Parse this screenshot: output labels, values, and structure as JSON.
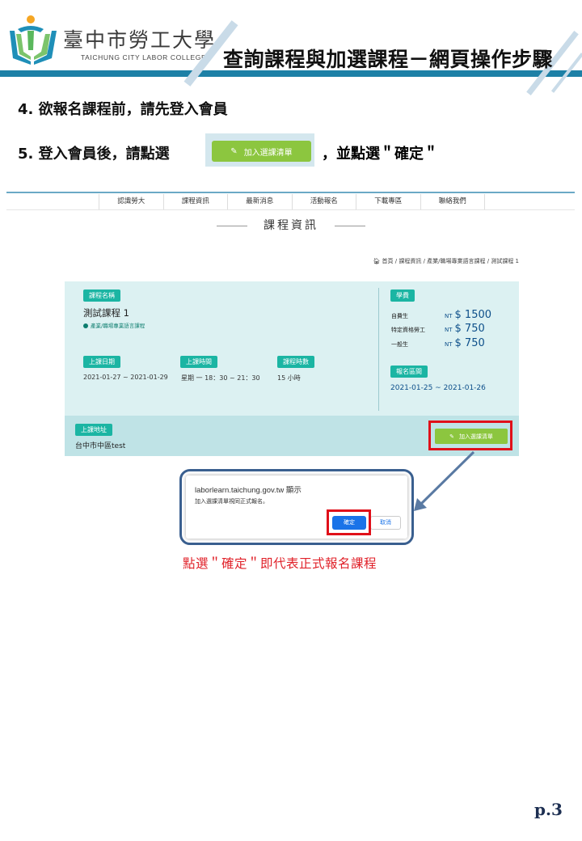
{
  "header": {
    "college_name_zh": "臺中市勞工大學",
    "college_name_en": "TAICHUNG CITY LABOR COLLEGE",
    "doc_title": "查詢課程與加選課程－網頁操作步驟",
    "bar_color": "#1d80a6"
  },
  "steps": {
    "step4": "4.  欲報名課程前，請先登入會員",
    "step5_prefix": "5.  登入會員後，請點選",
    "step5_suffix": "，並點選＂確定＂",
    "button_label": "加入選課清單"
  },
  "website": {
    "nav_items": [
      "認識勞大",
      "課程資訊",
      "最新消息",
      "活動報名",
      "下載專區",
      "聯絡我們"
    ],
    "section_title": "課程資訊",
    "breadcrumb": "首頁 / 課程資訊 / 產業/職場專業語言課程 / 測試課程 1",
    "course": {
      "name_tag": "課程名稱",
      "name": "測試課程 1",
      "category": "產業/職場專業語言課程",
      "date_tag": "上課日期",
      "date": "2021-01-27 ~ 2021-01-29",
      "time_tag": "上課時間",
      "time": "星期 一 18：30 ~ 21：30",
      "hours_tag": "課程時數",
      "hours": "15 小時",
      "fee_tag": "學費",
      "fees": [
        {
          "label": "自費生",
          "currency": "NT",
          "amount": "$ 1500"
        },
        {
          "label": "特定資格勞工",
          "currency": "NT",
          "amount": "$ 750"
        },
        {
          "label": "一般生",
          "currency": "NT",
          "amount": "$ 750"
        }
      ],
      "reg_tag": "報名區間",
      "reg_range": "2021-01-25 ~ 2021-01-26",
      "address_tag": "上課地址",
      "address": "台中市中區test",
      "add_button": "加入選課清單"
    }
  },
  "dialog": {
    "origin": "laborlearn.taichung.gov.tw 顯示",
    "message": "加入選課清單視同正式報名。",
    "ok": "確定",
    "cancel": "取消"
  },
  "caption": "點選＂確定＂即代表正式報名課程",
  "page_number": "p.3",
  "colors": {
    "accent_green": "#8cc63f",
    "tag_teal": "#1bb5a3",
    "highlight_red": "#e0101a",
    "caption_red": "#e0222a",
    "price_blue": "#0d4f8a"
  }
}
